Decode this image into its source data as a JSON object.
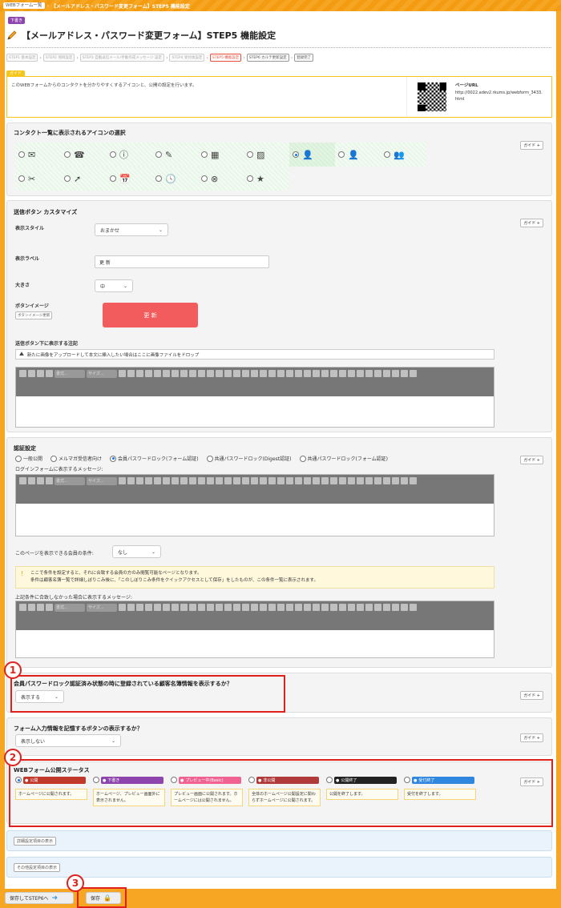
{
  "breadcrumb": {
    "home": "WEBフォーム一覧",
    "current": "【メールアドレス・パスワード変更フォーム】STEP5 機能設定"
  },
  "header": {
    "tag": "下書き",
    "title": "【メールアドレス・パスワード変更フォーム】STEP5 機能設定"
  },
  "steps": [
    {
      "label": "STEP1 基本設定"
    },
    {
      "label": "STEP2 項目設定"
    },
    {
      "label": "STEP3 自動返信メール/手動作成メッセージ 設定"
    },
    {
      "label": "STEP4 受付後設定"
    },
    {
      "label": "STEP5 機能設定"
    },
    {
      "label": "STEP6 カルテ更新設定"
    },
    {
      "label": "登録完了"
    }
  ],
  "guide": {
    "chip": "ガイド",
    "text": "このWEBフォームからのコンタクトを分かりやすくするアイコンと、公開の設定を行います。",
    "url_label": "ページURL",
    "url": "http://0022.adev2.rkums.jp/webform_3433.html"
  },
  "icon_section": {
    "title": "コンタクト一覧に表示されるアイコンの選択",
    "guide": "ガイド +",
    "icons": [
      "✉",
      "☎",
      "ⓘ",
      "✎",
      "▦",
      "▨",
      "👤",
      "👤",
      "👥",
      "✂",
      "➚",
      "📅",
      "🕓",
      "⊗",
      "★"
    ],
    "selected_index": 6
  },
  "send_button": {
    "title": "送信ボタン カスタマイズ",
    "style_label": "表示スタイル",
    "style_value": "おまかせ",
    "text_label": "表示ラベル",
    "text_value": "更 新",
    "size_label": "大きさ",
    "size_value": "中",
    "image_label": "ボタンイメージ",
    "image_btn": "ボタンイメージ更新",
    "preview": "更 新",
    "note_label": "送信ボタン下に表示する注記",
    "drop_text": "新たに画像をアップロードして本文に挿入したい場合はここに画像ファイルをドロップ",
    "guide": "ガイド +",
    "font_dd": "書式...",
    "size_dd": "サイズ..."
  },
  "auth": {
    "title": "認証設定",
    "options": [
      "一般公開",
      "メルマガ受信者向け",
      "会員パスワードロック(フォーム認証)",
      "共通パスワードロック(Digest認証)",
      "共通パスワードロック(フォーム認証)"
    ],
    "selected_index": 2,
    "login_msg_label": "ログインフォームに表示するメッセージ:",
    "cond_label": "このページを表示できる会員の条件:",
    "cond_value": "なし",
    "notice_line1": "ここで条件を設定すると、それに合致する会員の方のみ閲覧可能なページとなります。",
    "notice_line2": "条件は顧客名簿一覧で詳細しぼりこみ後に、「このしぼりこみ条件をクイックアクセスとして保存」をしたものが、この条件一覧に表示されます。",
    "fail_msg_label": "上記条件に合致しなかった場合に表示するメッセージ:",
    "guide": "ガイド +"
  },
  "member_info": {
    "title": "会員パスワードロック認証済み状態の時に登録されている顧客名簿情報を表示するか？",
    "value": "表示する",
    "guide": "ガイド +"
  },
  "remember": {
    "title": "フォーム入力情報を記憶するボタンの表示するか？",
    "value": "表示しない",
    "guide": "ガイド +"
  },
  "status": {
    "title": "WEBフォーム公開ステータス",
    "guide": "ガイド +",
    "selected_index": 0,
    "items": [
      {
        "label": "公開",
        "desc": "ホームページに公開されます。",
        "color": "#c0392b"
      },
      {
        "label": "下書き",
        "desc": "ホームページ、プレビュー画面外に表示されません。",
        "color": "#8e44ad"
      },
      {
        "label": "プレビュー中(Basic)",
        "desc": "プレビュー画面に公開されます。ホームページには公開されません。",
        "color": "#f06292"
      },
      {
        "label": "非公開",
        "desc": "全体のホームページ公開設定に関わらずホームページに公開されます。",
        "color": "#b03a3a"
      },
      {
        "label": "公開終了",
        "desc": "公開を終了します。",
        "color": "#222222"
      },
      {
        "label": "受付終了",
        "desc": "受付を終了します。",
        "color": "#2e86de"
      }
    ]
  },
  "links": {
    "detail": "詳細設定項目の表示",
    "other": "その他設定項目の表示"
  },
  "bottom": {
    "save_next": "保存してSTEP6へ",
    "save": "保存"
  },
  "annotations": [
    "1",
    "2",
    "3"
  ]
}
